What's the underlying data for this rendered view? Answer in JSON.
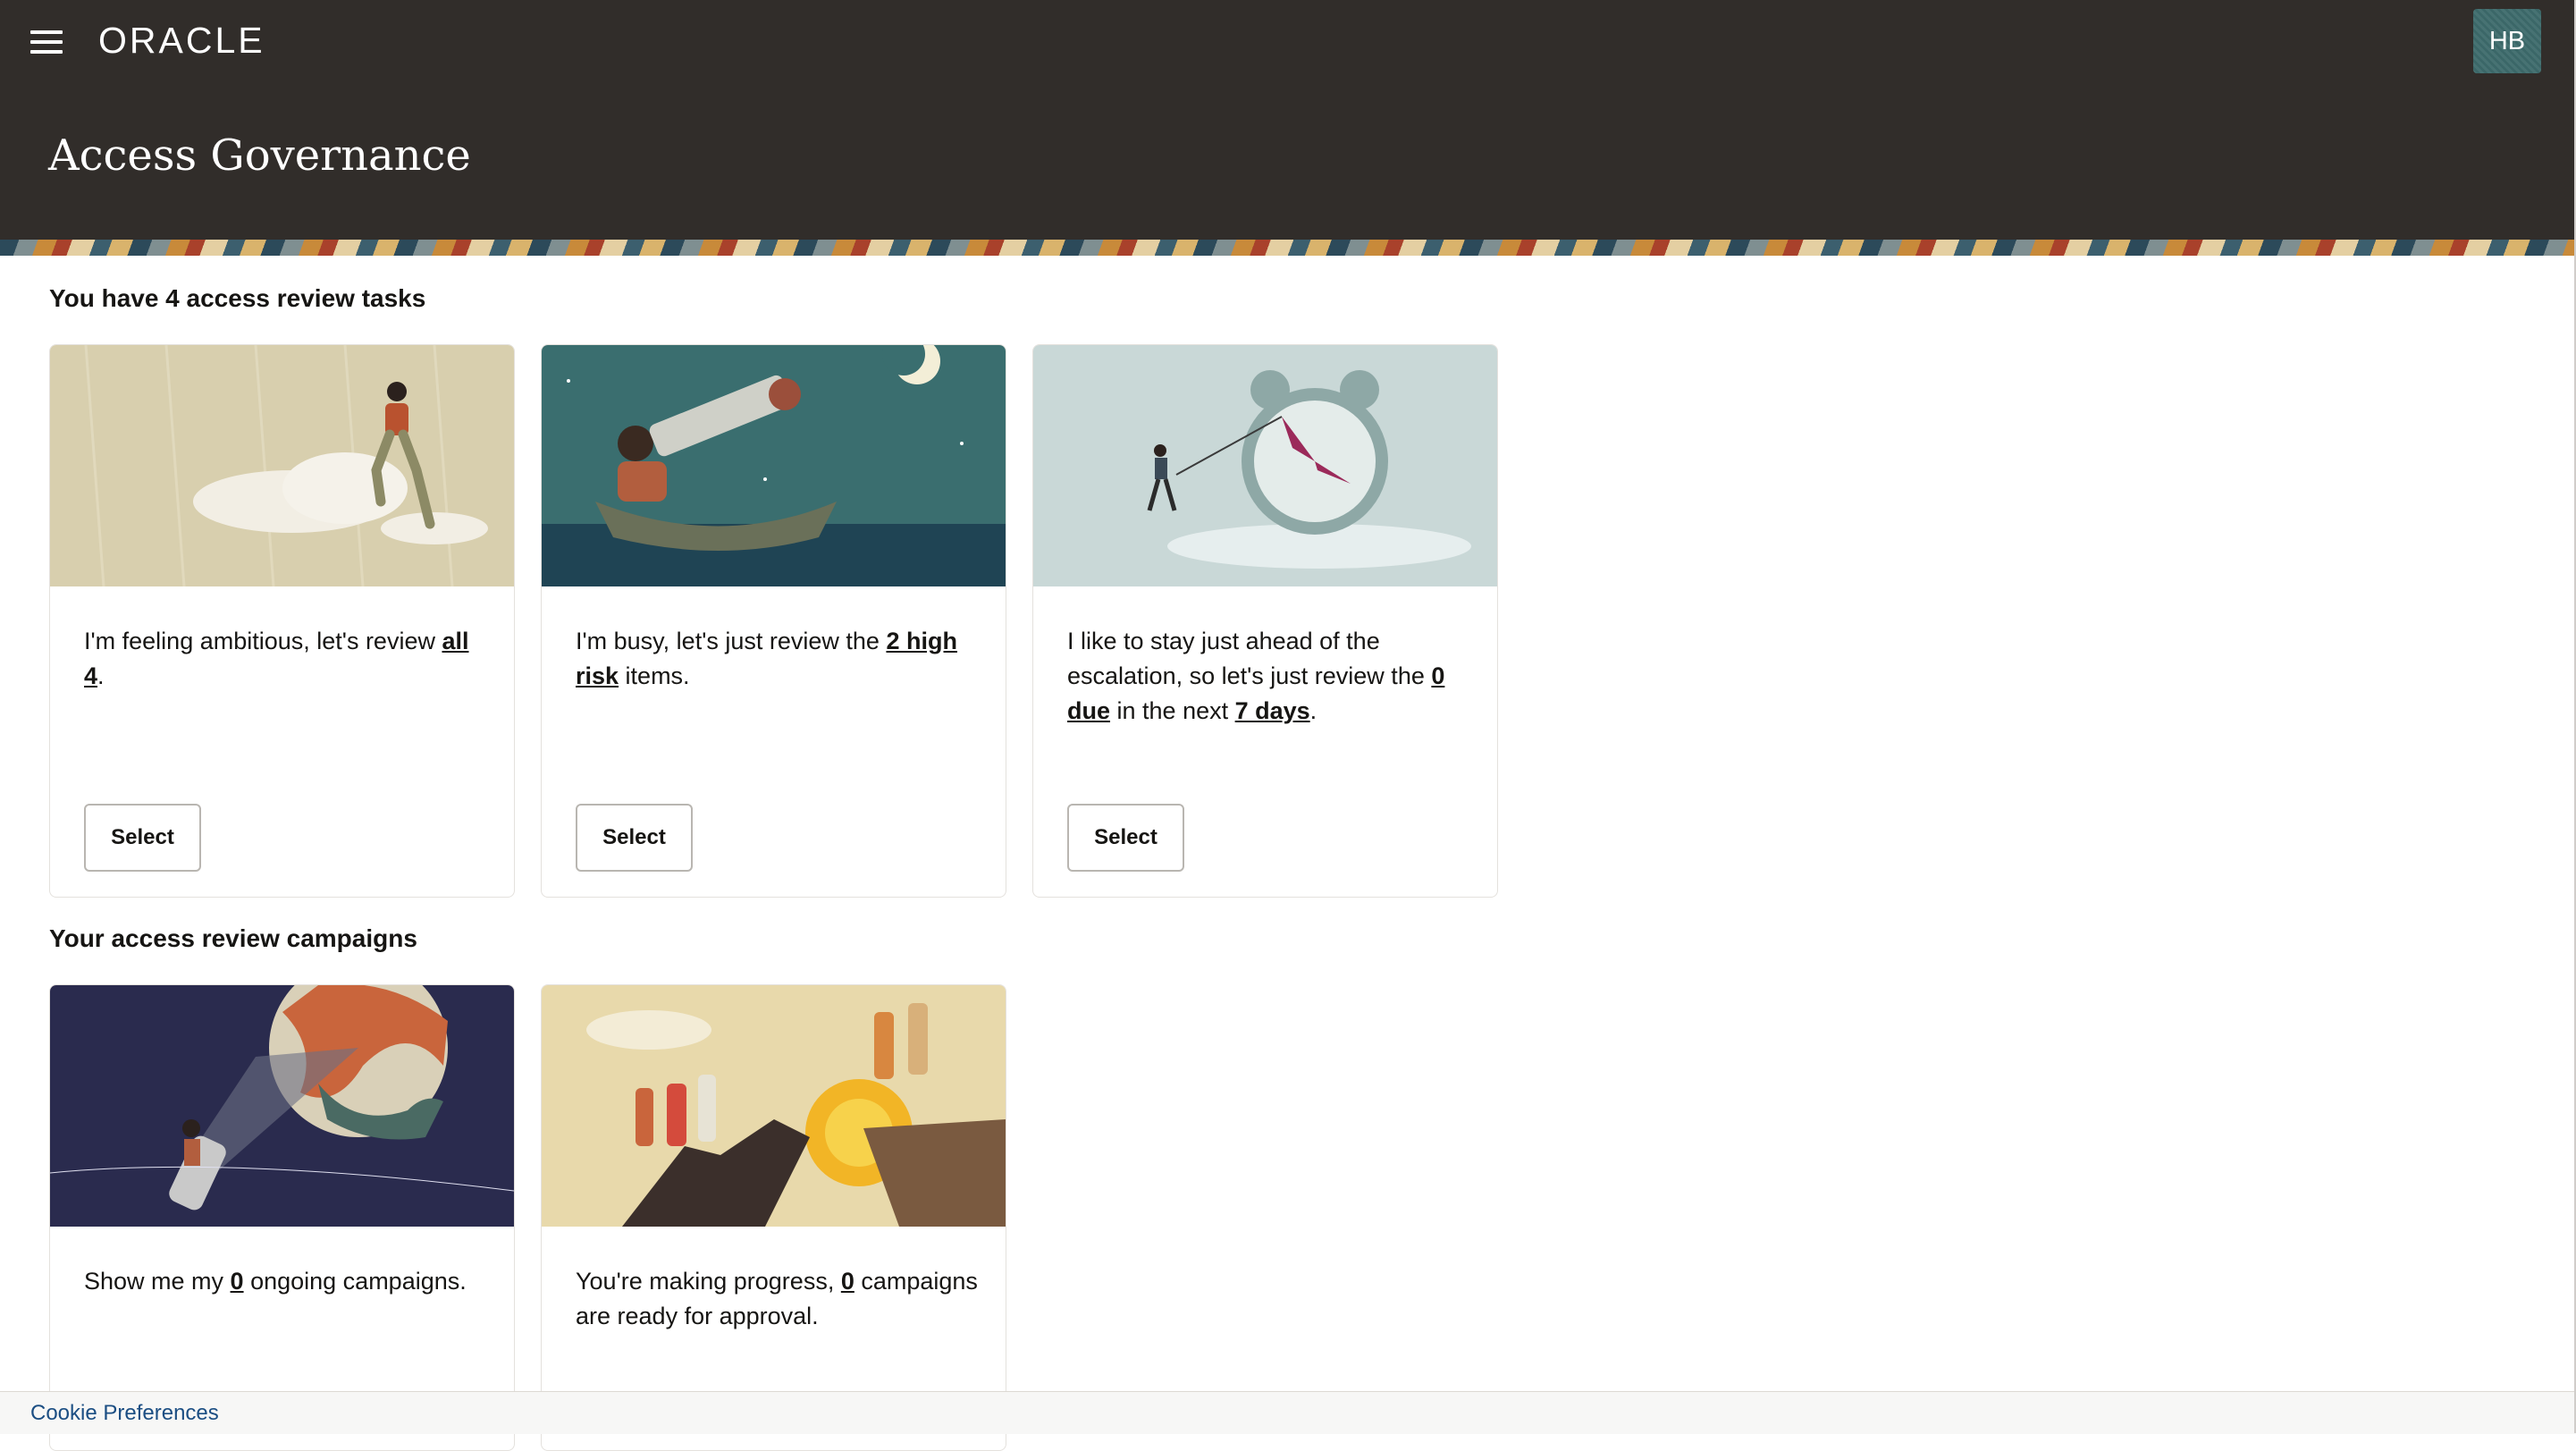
{
  "header": {
    "brand": "ORACLE",
    "title": "Access Governance",
    "avatar_initials": "HB",
    "colors": {
      "bar": "#312d2a",
      "avatar": "#3d6b6c"
    }
  },
  "tasks": {
    "heading": "You have 4 access review tasks",
    "cards": [
      {
        "image": "woman-climbing-cloud-illustration",
        "text_parts": [
          "I'm feeling ambitious, let's review ",
          "all 4",
          "."
        ],
        "button": "Select"
      },
      {
        "image": "telescope-boat-moon-illustration",
        "text_parts": [
          "I'm busy, let's just review the ",
          "2 high risk",
          " items."
        ],
        "button": "Select"
      },
      {
        "image": "person-pulling-clock-hand-illustration",
        "text_parts": [
          "I like to stay just ahead of the escalation, so let's just review the ",
          "0 due",
          " in the next ",
          "7 days",
          "."
        ],
        "button": "Select"
      }
    ]
  },
  "campaigns": {
    "heading": "Your access review campaigns",
    "cards": [
      {
        "image": "flashlight-moon-illustration",
        "text_parts": [
          "Show me my ",
          "0",
          " ongoing campaigns."
        ]
      },
      {
        "image": "people-on-cliff-sun-illustration",
        "text_parts": [
          "You're making progress, ",
          "0",
          " campaigns are ready for approval."
        ]
      }
    ]
  },
  "footer": {
    "cookie_link": "Cookie Preferences"
  }
}
